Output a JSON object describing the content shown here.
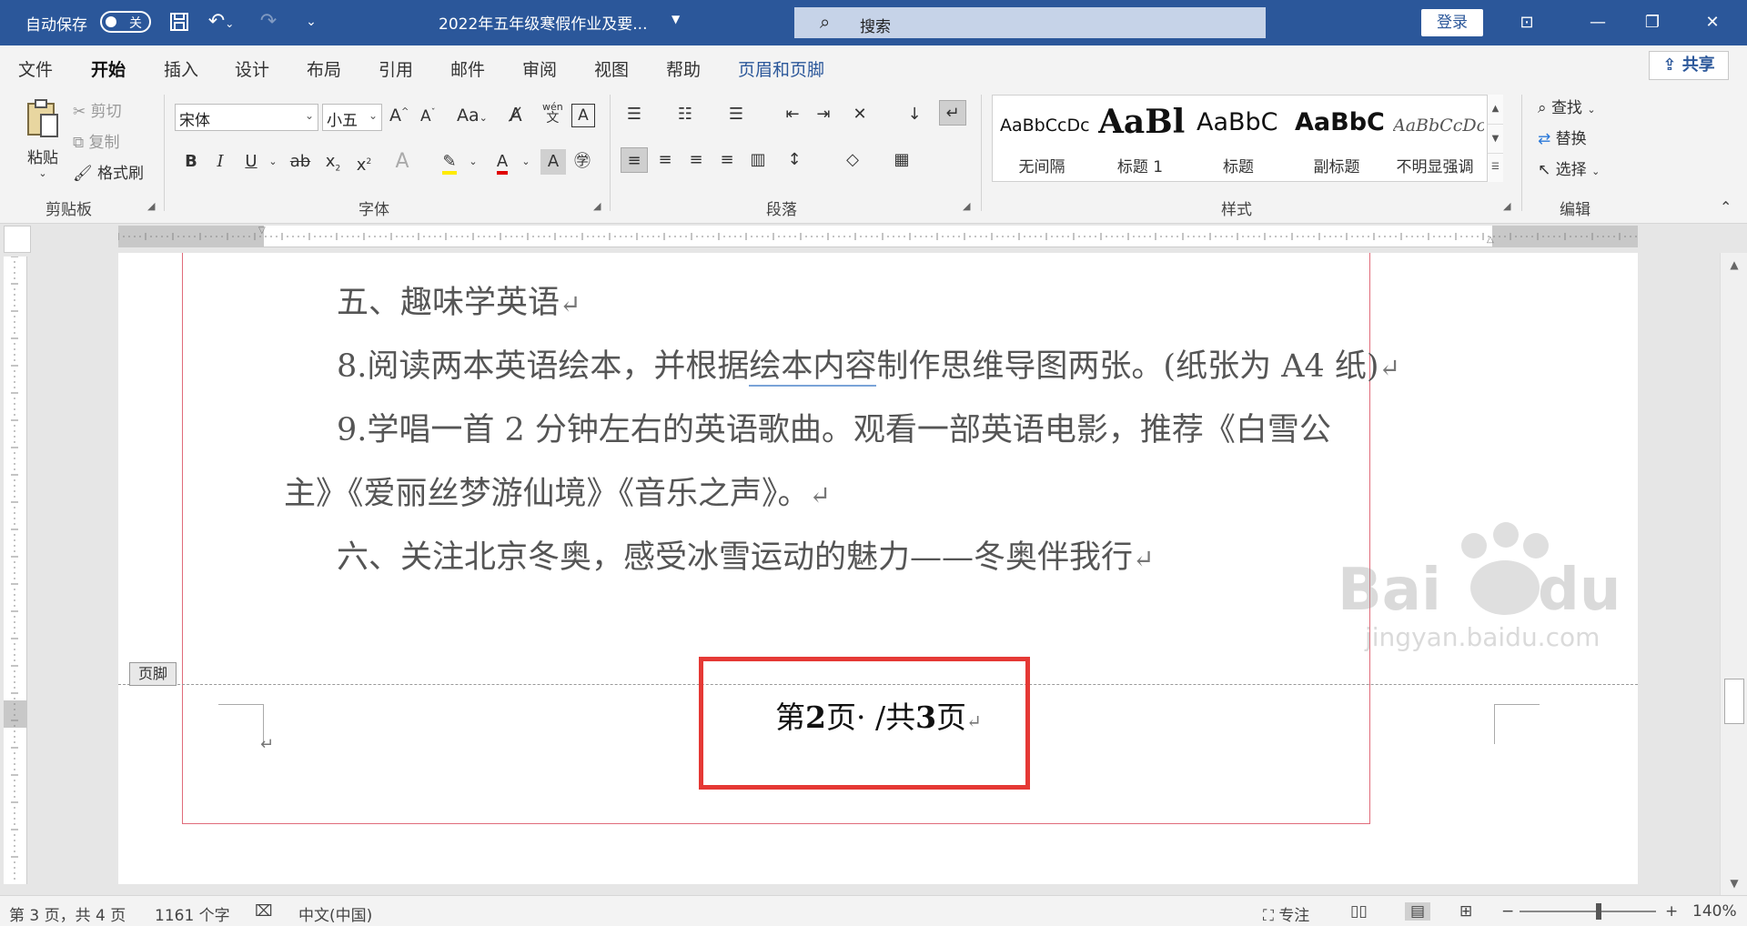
{
  "titlebar": {
    "autosave_label": "自动保存",
    "autosave_state": "关",
    "doc_title": "2022年五年级寒假作业及要...",
    "search_placeholder": "搜索",
    "login_label": "登录"
  },
  "tabs": [
    "文件",
    "开始",
    "插入",
    "设计",
    "布局",
    "引用",
    "邮件",
    "审阅",
    "视图",
    "帮助",
    "页眉和页脚"
  ],
  "active_tab": "开始",
  "share_label": "共享",
  "clipboard": {
    "paste": "粘贴",
    "cut": "剪切",
    "copy": "复制",
    "format_painter": "格式刷",
    "group_label": "剪贴板"
  },
  "font": {
    "font_name": "宋体",
    "font_size": "小五",
    "group_label": "字体"
  },
  "paragraph": {
    "group_label": "段落"
  },
  "styles": {
    "group_label": "样式",
    "items": [
      {
        "sample": "AaBbCcDc",
        "name": "无间隔"
      },
      {
        "sample": "AaBl",
        "name": "标题 1"
      },
      {
        "sample": "AaBbC",
        "name": "标题"
      },
      {
        "sample": "AaBbC",
        "name": "副标题"
      },
      {
        "sample": "AaBbCcDc",
        "name": "不明显强调"
      }
    ]
  },
  "editing": {
    "find": "查找",
    "replace": "替换",
    "select": "选择",
    "group_label": "编辑"
  },
  "document": {
    "lines": [
      "五、趣味学英语",
      "8.阅读两本英语绘本，并根据",
      "绘本内容",
      "制作思维导图两张。(纸张为 A4 纸)",
      "9.学唱一首 2 分钟左右的英语歌曲。观看一部英语电影，推荐《白雪公",
      "主》《爱丽丝梦游仙境》《音乐之声》。",
      "六、关注北京冬奥，感受冰雪运动的魅力——冬奥伴我行"
    ],
    "footer_label": "页脚",
    "footer_text_1": "第",
    "footer_num_1": "2",
    "footer_text_2": "页· /共",
    "footer_num_2": "3",
    "footer_text_3": "页"
  },
  "statusbar": {
    "page_info": "第 3 页，共 4 页",
    "word_count": "1161 个字",
    "language": "中文(中国)",
    "focus": "专注",
    "zoom": "140%"
  },
  "colors": {
    "titlebar": "#2b579a",
    "highlight_box": "#e53935",
    "page_border": "#e06b7a"
  }
}
